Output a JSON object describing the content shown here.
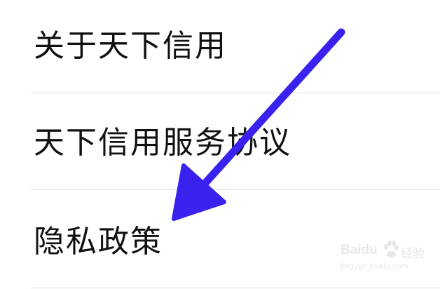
{
  "menu": {
    "items": [
      {
        "label": "关于天下信用"
      },
      {
        "label": "天下信用服务协议"
      },
      {
        "label": "隐私政策"
      }
    ]
  },
  "annotation": {
    "arrow_color": "#3a22ee",
    "icon": "arrow-pointing-down-left"
  },
  "watermark": {
    "brand": "Baidu",
    "brand_cn": "经验",
    "url": "jingyan.baidu.com"
  }
}
